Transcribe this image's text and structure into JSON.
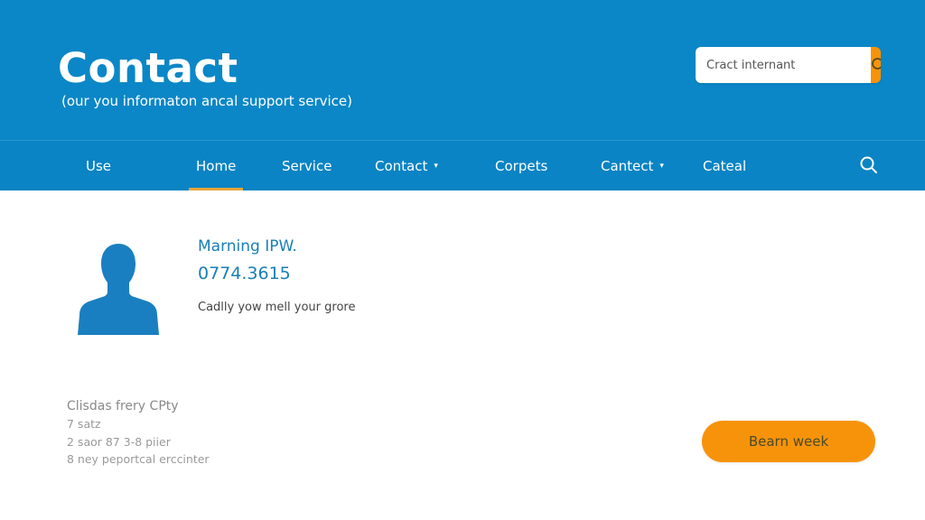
{
  "header": {
    "title": "Contact",
    "subtitle": "(our you informaton ancal support service)",
    "search": {
      "placeholder": "Cract internant",
      "button_icon": "search-icon"
    }
  },
  "nav": {
    "items": [
      {
        "label": "Use",
        "has_dropdown": false,
        "active": false
      },
      {
        "label": "Home",
        "has_dropdown": false,
        "active": true
      },
      {
        "label": "Service",
        "has_dropdown": false,
        "active": false
      },
      {
        "label": "Contact",
        "has_dropdown": true,
        "active": false
      },
      {
        "label": "Corpets",
        "has_dropdown": false,
        "active": false
      },
      {
        "label": "Cantect",
        "has_dropdown": true,
        "active": false
      },
      {
        "label": "Cateal",
        "has_dropdown": false,
        "active": false
      }
    ],
    "caret": "▾",
    "search_icon": "search-icon"
  },
  "contact": {
    "avatar_icon": "user-silhouette-icon",
    "name": "Marning IPW.",
    "phone": "0774.3615",
    "description": "Cadlly yow mell your grore"
  },
  "info": {
    "title": "Clisdas frery CPty",
    "lines": [
      "7 satz",
      "2 saor 87 3-8 piier",
      "8 ney peportcal erccinter"
    ]
  },
  "cta": {
    "label": "Bearn week"
  },
  "colors": {
    "header_bg": "#0b87c7",
    "nav_bg": "#0a84c4",
    "accent_orange": "#f7930a",
    "active_underline": "#e8a53a",
    "contact_text": "#1a7fb5",
    "avatar": "#1a7fc0"
  }
}
